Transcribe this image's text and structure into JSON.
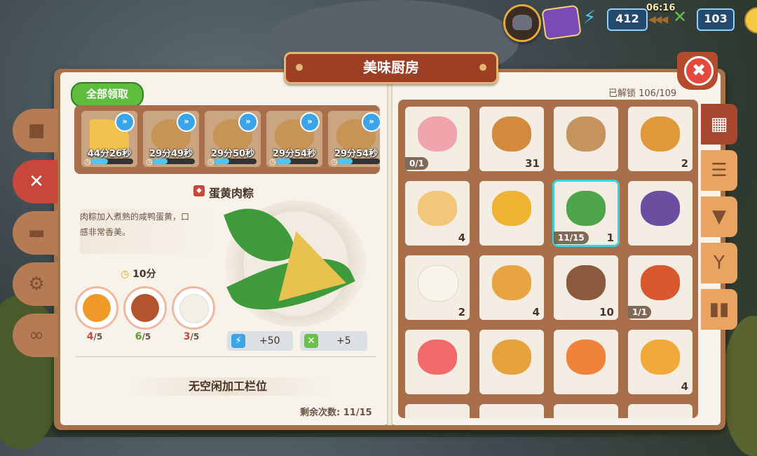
{
  "hud": {
    "energy_value": "412",
    "timer": "06:16",
    "timer_arrows": "◀◀◀",
    "food_value": "103"
  },
  "title": "美味厨房",
  "close_label": "✖",
  "left_panel": {
    "claim_all_label": "全部领取",
    "queue": [
      {
        "time": "44分26秒",
        "progress": 0.4,
        "color": "#f2c24e"
      },
      {
        "time": "29分49秒",
        "progress": 0.35,
        "color": "#a9693b"
      },
      {
        "time": "29分50秒",
        "progress": 0.35,
        "color": "#a9693b"
      },
      {
        "time": "29分54秒",
        "progress": 0.35,
        "color": "#a9693b"
      },
      {
        "time": "29分54秒",
        "progress": 0.35,
        "color": "#a9693b"
      }
    ],
    "dish": {
      "name": "蛋黄肉粽",
      "description_line1": "肉粽加入煮熟的咸鸭蛋黄，口",
      "description_line2": "感非常香美。",
      "cook_time": "10分",
      "ingredients": [
        {
          "have": "4",
          "need": "/5",
          "color": "#f09a2a",
          "count_color": "#c9473a"
        },
        {
          "have": "6",
          "need": "/5",
          "color": "#b4542f",
          "count_color": "#5a9a2a"
        },
        {
          "have": "3",
          "need": "/5",
          "color": "#f4efe6",
          "count_color": "#c9473a"
        }
      ],
      "energy_reward": "+50",
      "food_reward": "+5"
    },
    "no_slot_text": "无空闲加工栏位",
    "remaining_text": "剩余次数: 11/15"
  },
  "right_panel": {
    "unlocked_text": "已解锁  106/109",
    "items": [
      {
        "count": "",
        "progress": "0/1",
        "color": "#f0a5ad"
      },
      {
        "count": "31",
        "progress": "",
        "color": "#d48a3c"
      },
      {
        "count": "",
        "progress": "",
        "color": "#c4935e"
      },
      {
        "count": "2",
        "progress": "",
        "color": "#e0993a"
      },
      {
        "count": "4",
        "progress": "",
        "color": "#f2c77a"
      },
      {
        "count": "",
        "progress": "",
        "color": "#f0b232"
      },
      {
        "count": "1",
        "progress": "11/15",
        "color": "#4fa64a",
        "selected": true
      },
      {
        "count": "",
        "progress": "",
        "color": "#6c4ea0"
      },
      {
        "count": "2",
        "progress": "",
        "color": "#f8f4ea"
      },
      {
        "count": "4",
        "progress": "",
        "color": "#e8a440"
      },
      {
        "count": "10",
        "progress": "",
        "color": "#8b5a3c"
      },
      {
        "count": "",
        "progress": "1/1",
        "color": "#d9582e"
      },
      {
        "count": "",
        "progress": "",
        "color": "#f06a6a"
      },
      {
        "count": "",
        "progress": "",
        "color": "#e6a23c"
      },
      {
        "count": "",
        "progress": "",
        "color": "#f0823a"
      },
      {
        "count": "4",
        "progress": "",
        "color": "#f2a93a"
      }
    ],
    "category_icons": [
      "grid-icon",
      "burger-icon",
      "ice-cream-icon",
      "drink-icon",
      "shaker-icon"
    ]
  }
}
